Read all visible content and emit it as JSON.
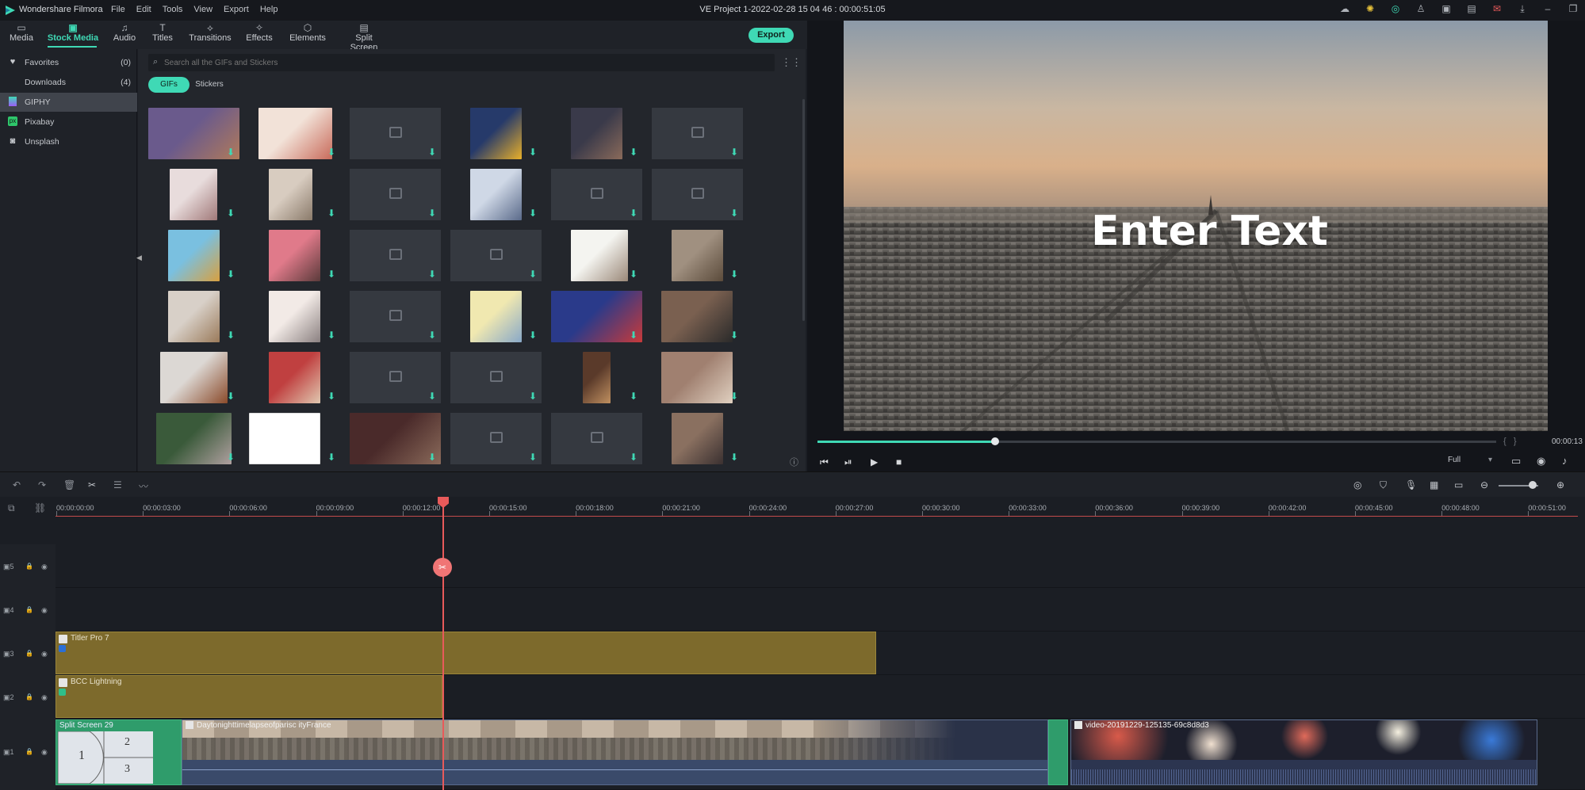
{
  "titlebar": {
    "app_name": "Wondershare Filmora",
    "menus": [
      "File",
      "Edit",
      "Tools",
      "View",
      "Export",
      "Help"
    ],
    "project_title": "VE Project 1-2022-02-28 15 04 46 : 00:00:51:05"
  },
  "toolbar": {
    "tabs": [
      {
        "label": "Media",
        "icon": "folder-icon"
      },
      {
        "label": "Stock Media",
        "icon": "stock-media-icon"
      },
      {
        "label": "Audio",
        "icon": "music-icon"
      },
      {
        "label": "Titles",
        "icon": "titles-icon"
      },
      {
        "label": "Transitions",
        "icon": "transitions-icon"
      },
      {
        "label": "Effects",
        "icon": "effects-icon"
      },
      {
        "label": "Elements",
        "icon": "elements-icon"
      },
      {
        "label": "Split Screen",
        "icon": "split-screen-icon"
      }
    ],
    "active_tab": "Stock Media",
    "export_label": "Export"
  },
  "sidebar": {
    "items": [
      {
        "label": "Favorites",
        "count": "(0)",
        "icon": "heart-icon"
      },
      {
        "label": "Downloads",
        "count": "(4)",
        "icon": ""
      },
      {
        "label": "GIPHY",
        "count": "",
        "icon": "giphy-icon"
      },
      {
        "label": "Pixabay",
        "count": "",
        "icon": "pixabay-icon"
      },
      {
        "label": "Unsplash",
        "count": "",
        "icon": "unsplash-icon"
      }
    ],
    "active": "GIPHY"
  },
  "search": {
    "placeholder": "Search all the GIFs and Stickers"
  },
  "filters": {
    "gifs": "GIFs",
    "stickers": "Stickers"
  },
  "preview": {
    "overlay_text": "Enter Text",
    "timecode": "00:00:13",
    "progress_fraction": 0.2,
    "quality": "Full"
  },
  "timeline": {
    "ruler_labels": [
      "00:00:00:00",
      "00:00:03:00",
      "00:00:06:00",
      "00:00:09:00",
      "00:00:12:00",
      "00:00:15:00",
      "00:00:18:00",
      "00:00:21:00",
      "00:00:24:00",
      "00:00:27:00",
      "00:00:30:00",
      "00:00:33:00",
      "00:00:36:00",
      "00:00:39:00",
      "00:00:42:00",
      "00:00:45:00",
      "00:00:48:00",
      "00:00:51:00"
    ],
    "track_numbers": [
      "5",
      "4",
      "3",
      "2",
      "1"
    ],
    "clips": {
      "title_pro": "Titler Pro 7",
      "bcc": "BCC Lightning",
      "split_screen": "Split Screen 29",
      "paris_video": "Daytonighttimelapseofparisc ityFrance",
      "concert_video": "video-20191229-125135-69c8d8d3",
      "split_numbers": [
        "1",
        "2",
        "3"
      ]
    }
  },
  "colors": {
    "accent": "#3fd9b5",
    "playhead": "#e85a5a",
    "title_clip": "#7d6a2c"
  }
}
